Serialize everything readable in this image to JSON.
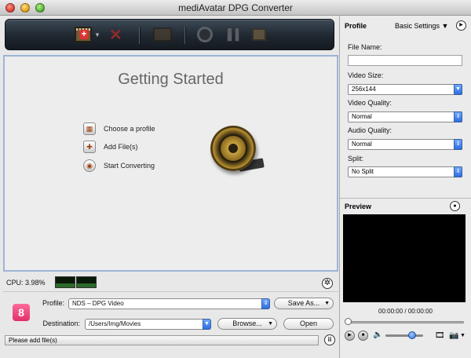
{
  "window": {
    "title": "mediAvatar DPG Converter"
  },
  "workspace": {
    "heading": "Getting Started",
    "steps": [
      {
        "label": "Choose a profile",
        "icon": "profile-icon"
      },
      {
        "label": "Add File(s)",
        "icon": "add-file-icon"
      },
      {
        "label": "Start Converting",
        "icon": "convert-icon"
      }
    ]
  },
  "cpu": {
    "label": "CPU: 3.98%"
  },
  "bottom": {
    "profile_label": "Profile:",
    "profile_value": "NDS – DPG Video",
    "save_as_label": "Save As...",
    "destination_label": "Destination:",
    "destination_value": "/Users/Img/Movies",
    "browse_label": "Browse...",
    "open_label": "Open",
    "status_text": "Please add file(s)"
  },
  "sidebar": {
    "title": "Profile",
    "basic_settings": "Basic Settings",
    "file_name_label": "File Name:",
    "file_name_value": "",
    "video_size_label": "Video Size:",
    "video_size_value": "256x144",
    "video_quality_label": "Video Quality:",
    "video_quality_value": "Normal",
    "audio_quality_label": "Audio Quality:",
    "audio_quality_value": "Normal",
    "split_label": "Split:",
    "split_value": "No Split"
  },
  "preview": {
    "title": "Preview",
    "time": "00:00:00 / 00:00:00"
  },
  "colors": {
    "accent": "#2c6fe0",
    "workspace_border": "#9db4d6",
    "badge": "#e0306a"
  }
}
